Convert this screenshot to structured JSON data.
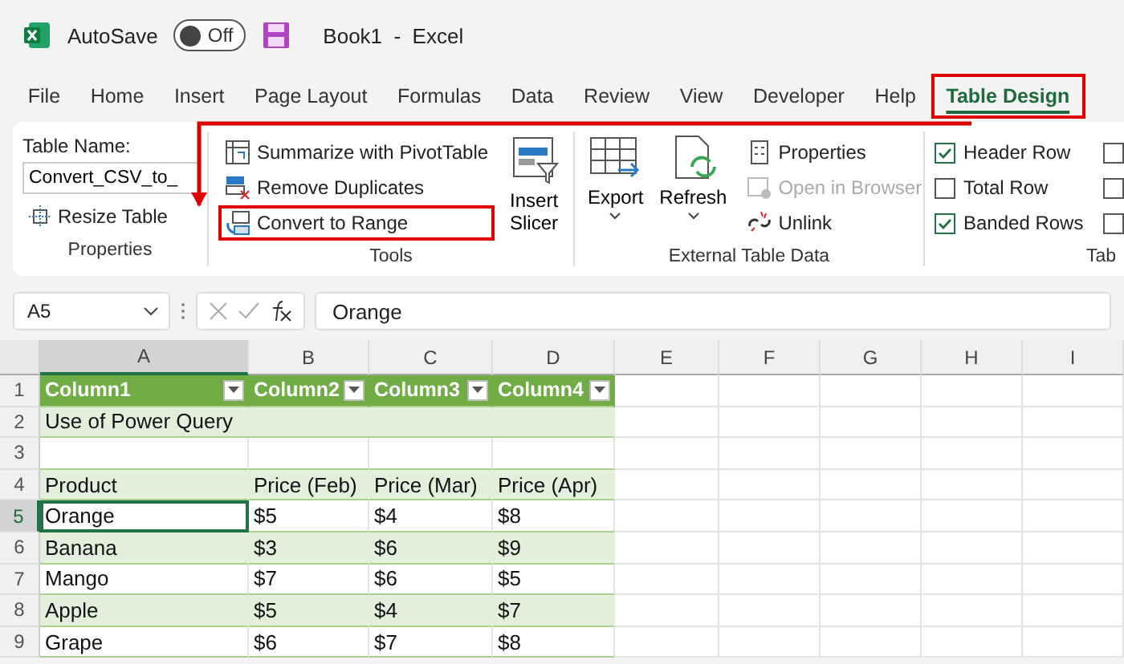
{
  "title_bar": {
    "autosave_label": "AutoSave",
    "autosave": {
      "label": "Off",
      "on": false
    },
    "title": "Book1  -  Excel"
  },
  "menu_tabs": [
    {
      "label": "File",
      "selected": false
    },
    {
      "label": "Home",
      "selected": false
    },
    {
      "label": "Insert",
      "selected": false
    },
    {
      "label": "Page Layout",
      "selected": false
    },
    {
      "label": "Formulas",
      "selected": false
    },
    {
      "label": "Data",
      "selected": false
    },
    {
      "label": "Review",
      "selected": false
    },
    {
      "label": "View",
      "selected": false
    },
    {
      "label": "Developer",
      "selected": false
    },
    {
      "label": "Help",
      "selected": false
    },
    {
      "label": "Table Design",
      "selected": true
    }
  ],
  "ribbon": {
    "properties": {
      "table_name_label": "Table Name:",
      "table_name": "Convert_CSV_to_",
      "resize": "Resize Table",
      "group_label": "Properties"
    },
    "tools": {
      "buttons": [
        {
          "label": "Summarize with PivotTable"
        },
        {
          "label": "Remove Duplicates"
        },
        {
          "label": "Convert to Range"
        }
      ],
      "slicer": "Insert Slicer",
      "group_label": "Tools"
    },
    "external": {
      "export": "Export",
      "refresh": "Refresh",
      "buttons": [
        {
          "label": "Properties",
          "disabled": false
        },
        {
          "label": "Open in Browser",
          "disabled": true
        },
        {
          "label": "Unlink",
          "disabled": false
        }
      ],
      "group_label": "External Table Data"
    },
    "style_options": {
      "checkboxes": [
        {
          "label": "Header Row",
          "checked": true
        },
        {
          "label": "Total Row",
          "checked": false
        },
        {
          "label": "Banded Rows",
          "checked": true
        }
      ],
      "more_checkboxes": [
        {
          "checked": false
        },
        {
          "checked": false
        },
        {
          "checked": false
        }
      ],
      "group_label": "Tab"
    }
  },
  "formula_bar": {
    "name_box": "A5",
    "value": "Orange"
  },
  "sheet": {
    "columns": [
      {
        "label": "A",
        "selected": true
      },
      {
        "label": "B",
        "selected": false
      },
      {
        "label": "C",
        "selected": false
      },
      {
        "label": "D",
        "selected": false
      },
      {
        "label": "E",
        "selected": false
      },
      {
        "label": "F",
        "selected": false
      },
      {
        "label": "G",
        "selected": false
      },
      {
        "label": "H",
        "selected": false
      },
      {
        "label": "I",
        "selected": false
      }
    ],
    "rows": [
      {
        "number": "1",
        "kind": "header",
        "selected": false,
        "cells": [
          "Column1",
          "Column2",
          "Column3",
          "Column4"
        ]
      },
      {
        "number": "2",
        "kind": "band",
        "selected": false,
        "cells": [
          "Use of Power Query"
        ]
      },
      {
        "number": "3",
        "kind": "plain",
        "selected": false,
        "cells": []
      },
      {
        "number": "4",
        "kind": "band",
        "selected": false,
        "cells": [
          "Product",
          "Price (Feb)",
          "Price (Mar)",
          "Price (Apr)"
        ]
      },
      {
        "number": "5",
        "kind": "plain",
        "selected": true,
        "cells": [
          "Orange",
          "$5",
          "$4",
          "$8"
        ]
      },
      {
        "number": "6",
        "kind": "band",
        "selected": false,
        "cells": [
          "Banana",
          "$3",
          "$6",
          "$9"
        ]
      },
      {
        "number": "7",
        "kind": "plain",
        "selected": false,
        "cells": [
          "Mango",
          "$7",
          "$6",
          "$5"
        ]
      },
      {
        "number": "8",
        "kind": "band",
        "selected": false,
        "cells": [
          "Apple",
          "$5",
          "$4",
          "$7"
        ]
      },
      {
        "number": "9",
        "kind": "plain",
        "selected": false,
        "cells": [
          "Grape",
          "$6",
          "$7",
          "$8"
        ]
      }
    ]
  }
}
